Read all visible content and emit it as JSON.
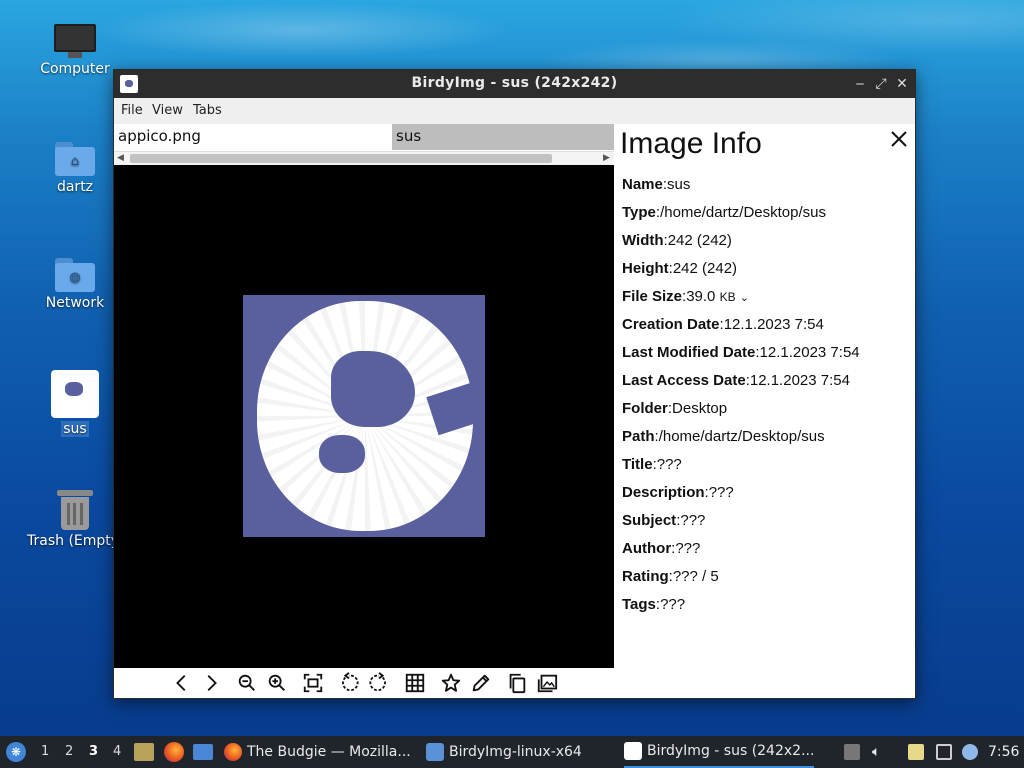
{
  "desktop": {
    "icons": [
      {
        "label": "Computer"
      },
      {
        "label": "dartz"
      },
      {
        "label": "Network"
      },
      {
        "label": "sus"
      },
      {
        "label": "Trash (Empty)"
      }
    ]
  },
  "window": {
    "title": "BirdyImg - sus (242x242)",
    "menu": {
      "file": "File",
      "view": "View",
      "tabs": "Tabs"
    },
    "tabs": [
      {
        "label": "appico.png"
      },
      {
        "label": "sus"
      }
    ],
    "toolbar_icons": [
      "prev-icon",
      "next-icon",
      "zoom-out-icon",
      "zoom-in-icon",
      "fit-icon",
      "rotate-left-icon",
      "rotate-right-icon",
      "grid-icon",
      "star-icon",
      "edit-icon",
      "copy-icon",
      "gallery-icon"
    ]
  },
  "info_panel": {
    "title": "Image Info",
    "fields": [
      {
        "key": "Name",
        "value": "sus"
      },
      {
        "key": "Type",
        "value": "/home/dartz/Desktop/sus"
      },
      {
        "key": "Width",
        "value": "242 (242)"
      },
      {
        "key": "Height",
        "value": "242 (242)"
      },
      {
        "key": "File Size",
        "value": "39.0",
        "unit": "KB"
      },
      {
        "key": "Creation Date",
        "value": "12.1.2023 7:54"
      },
      {
        "key": "Last Modified Date",
        "value": "12.1.2023 7:54"
      },
      {
        "key": "Last Access Date",
        "value": "12.1.2023 7:54"
      },
      {
        "key": "Folder",
        "value": "Desktop"
      },
      {
        "key": "Path",
        "value": "/home/dartz/Desktop/sus"
      },
      {
        "key": "Title",
        "value": "???"
      },
      {
        "key": "Description",
        "value": "???"
      },
      {
        "key": "Subject",
        "value": "???"
      },
      {
        "key": "Author",
        "value": "???"
      },
      {
        "key": "Rating",
        "value": "??? / 5"
      },
      {
        "key": "Tags",
        "value": "???"
      }
    ]
  },
  "taskbar": {
    "workspaces": [
      "1",
      "2",
      "3",
      "4"
    ],
    "active_workspace": "3",
    "tasks": [
      {
        "label": "The Budgie — Mozilla..."
      },
      {
        "label": "BirdyImg-linux-x64"
      },
      {
        "label": "BirdyImg - sus (242x2..."
      }
    ],
    "clock": "7:56"
  },
  "colors": {
    "image_bg": "#5a5f9e",
    "titlebar": "#2d2d2d",
    "taskbar": "#20242b",
    "active_task_underline": "#3a8fe0"
  }
}
